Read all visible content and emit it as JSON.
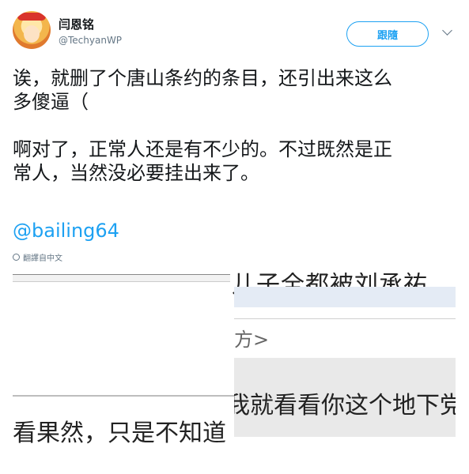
{
  "user": {
    "display_name": "闫恩铭",
    "handle": "@TechyanWP"
  },
  "follow_button": "跟隨",
  "tweet": {
    "paragraphs": "诶，就删了个唐山条约的条目，还引出来这么\n多傻逼（\n\n啊对了，正常人还是有不少的。不过既然是正\n常人，当然没必要挂出来了。",
    "mention": "@bailing64",
    "translate_label": "翻譯自中文"
  },
  "media": {
    "text_top": "儿子全都被刘承祐",
    "text_place": "方>",
    "text_middle": "我就看看你这个地下党",
    "text_bottom": "看果然，只是不知道"
  }
}
